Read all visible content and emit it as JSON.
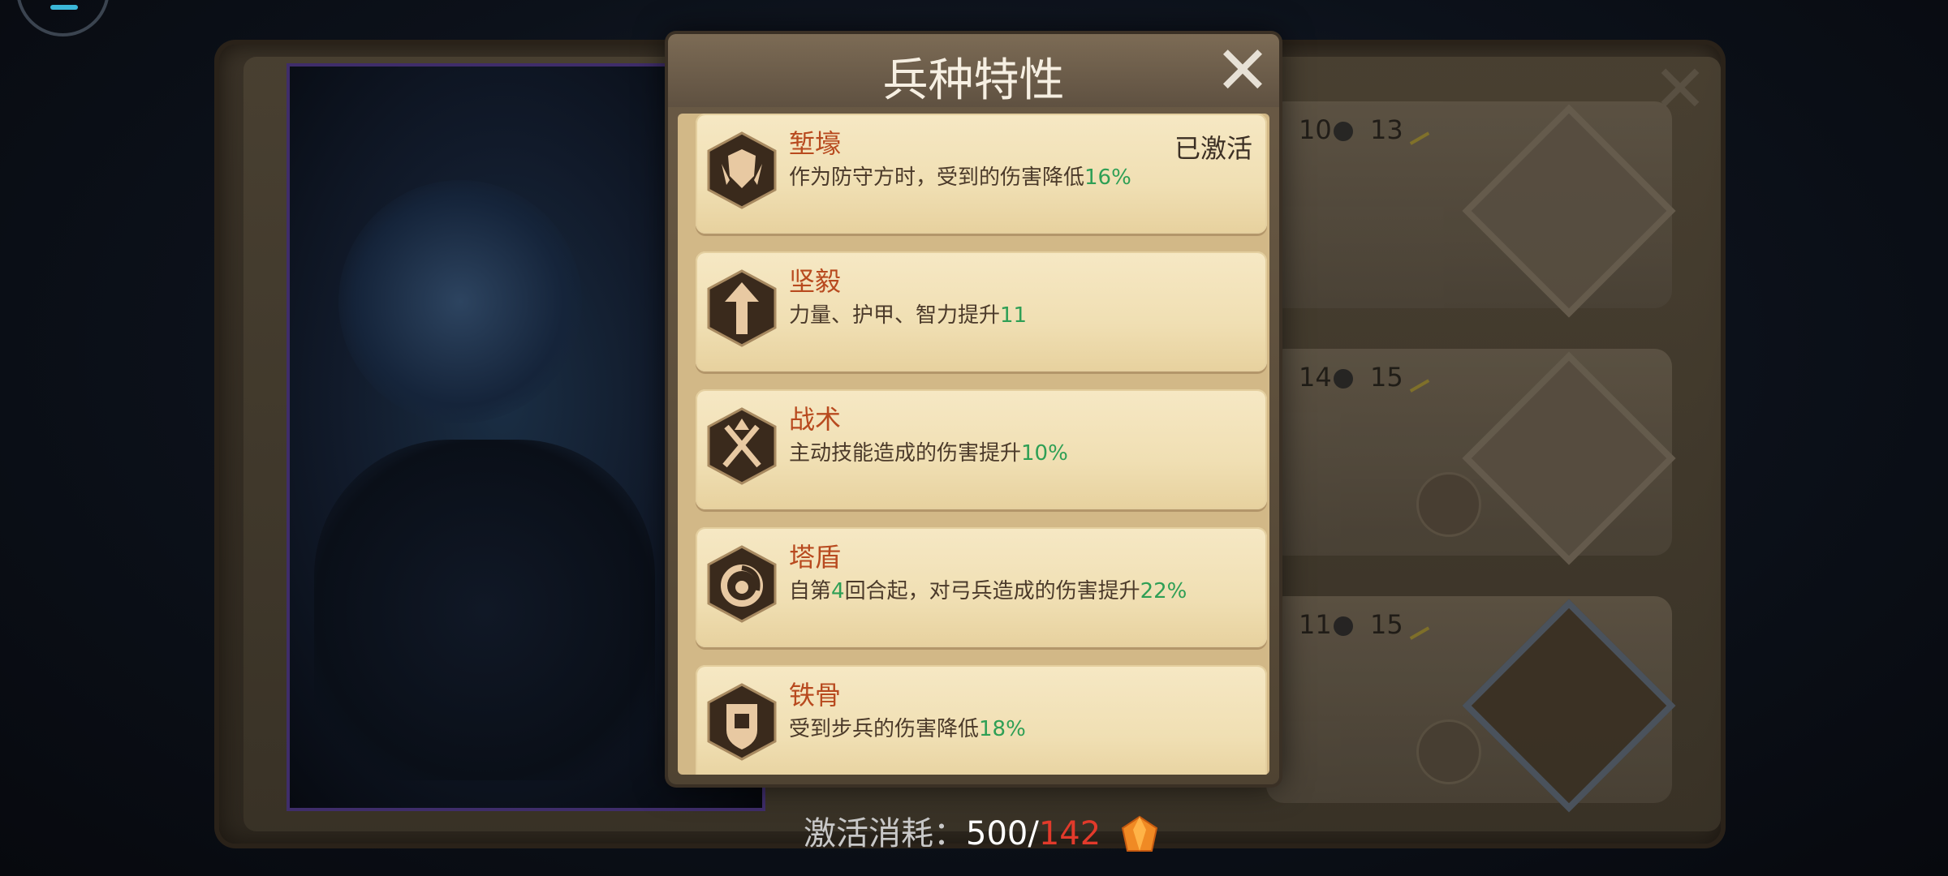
{
  "modal": {
    "title": "兵种特性",
    "close_icon": "close-icon"
  },
  "traits": [
    {
      "name": "堑壕",
      "desc_prefix": "作为防守方时，受到的伤害降低",
      "desc_value": "16%",
      "badge": "已激活",
      "icon": "shield-wings-icon"
    },
    {
      "name": "坚毅",
      "desc_prefix": "力量、护甲、智力提升",
      "desc_value": "11",
      "icon": "sword-up-icon"
    },
    {
      "name": "战术",
      "desc_prefix": "主动技能造成的伤害提升",
      "desc_value": "10%",
      "icon": "crossed-swords-icon"
    },
    {
      "name": "塔盾",
      "desc_prefix": "自第",
      "desc_mid_value": "4",
      "desc_mid": "回合起，对弓兵造成的伤害提升",
      "desc_value": "22%",
      "icon": "swirl-icon"
    },
    {
      "name": "铁骨",
      "desc_prefix": "受到步兵的伤害降低",
      "desc_value": "18%",
      "icon": "tower-shield-icon"
    }
  ],
  "right_cards": [
    {
      "stat_a": "10",
      "stat_b": "13"
    },
    {
      "stat_a": "14",
      "stat_b": "15"
    },
    {
      "stat_a": "11",
      "stat_b": "15"
    }
  ],
  "cost": {
    "label": "激活消耗：",
    "current": "500",
    "separator": "/",
    "required": "142",
    "icon": "orange-gem-icon"
  }
}
